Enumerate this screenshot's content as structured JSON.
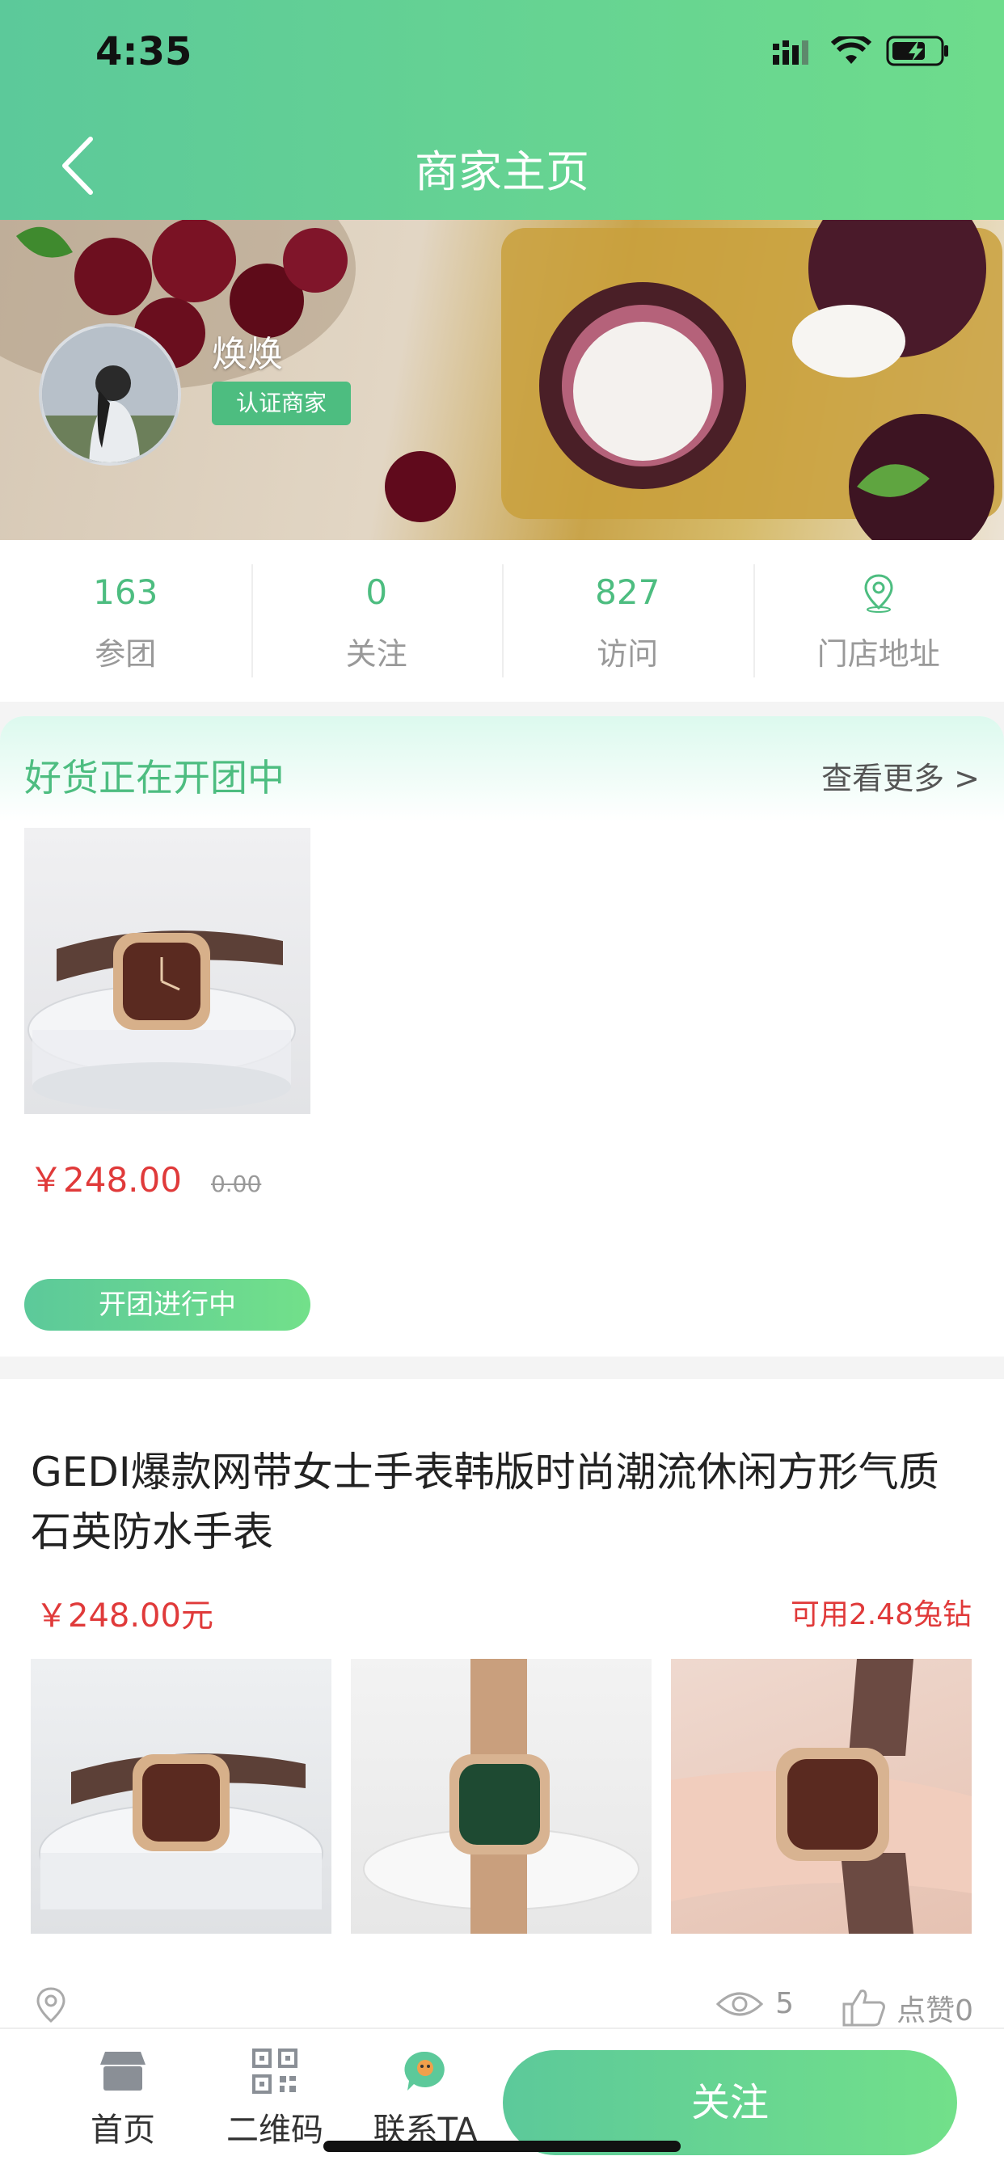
{
  "status_bar": {
    "time": "4:35"
  },
  "header": {
    "title": "商家主页"
  },
  "merchant": {
    "name": "焕焕",
    "badge": "认证商家"
  },
  "stats": [
    {
      "value": "163",
      "label": "参团"
    },
    {
      "value": "0",
      "label": "关注"
    },
    {
      "value": "827",
      "label": "访问"
    },
    {
      "value": "",
      "label": "门店地址",
      "icon": "location-pin-icon"
    }
  ],
  "group_buy": {
    "title": "好货正在开团中",
    "see_more": "查看更多 >",
    "product": {
      "price": "￥248.00",
      "original_price": "0.00",
      "status": "开团进行中"
    }
  },
  "post": {
    "title": "GEDI爆款网带女士手表韩版时尚潮流休闲方形气质石英防水手表",
    "price": "￥248.00元",
    "credit": "可用2.48兔钻",
    "views": "5",
    "likes": "点赞0"
  },
  "bottom_nav": {
    "home": "首页",
    "qr": "二维码",
    "contact": "联系TA",
    "follow": "关注"
  },
  "colors": {
    "brand_green": "#4dbd80",
    "price_red": "#e03a3a",
    "gradient_start": "#5cc99a",
    "gradient_end": "#72e08a"
  }
}
